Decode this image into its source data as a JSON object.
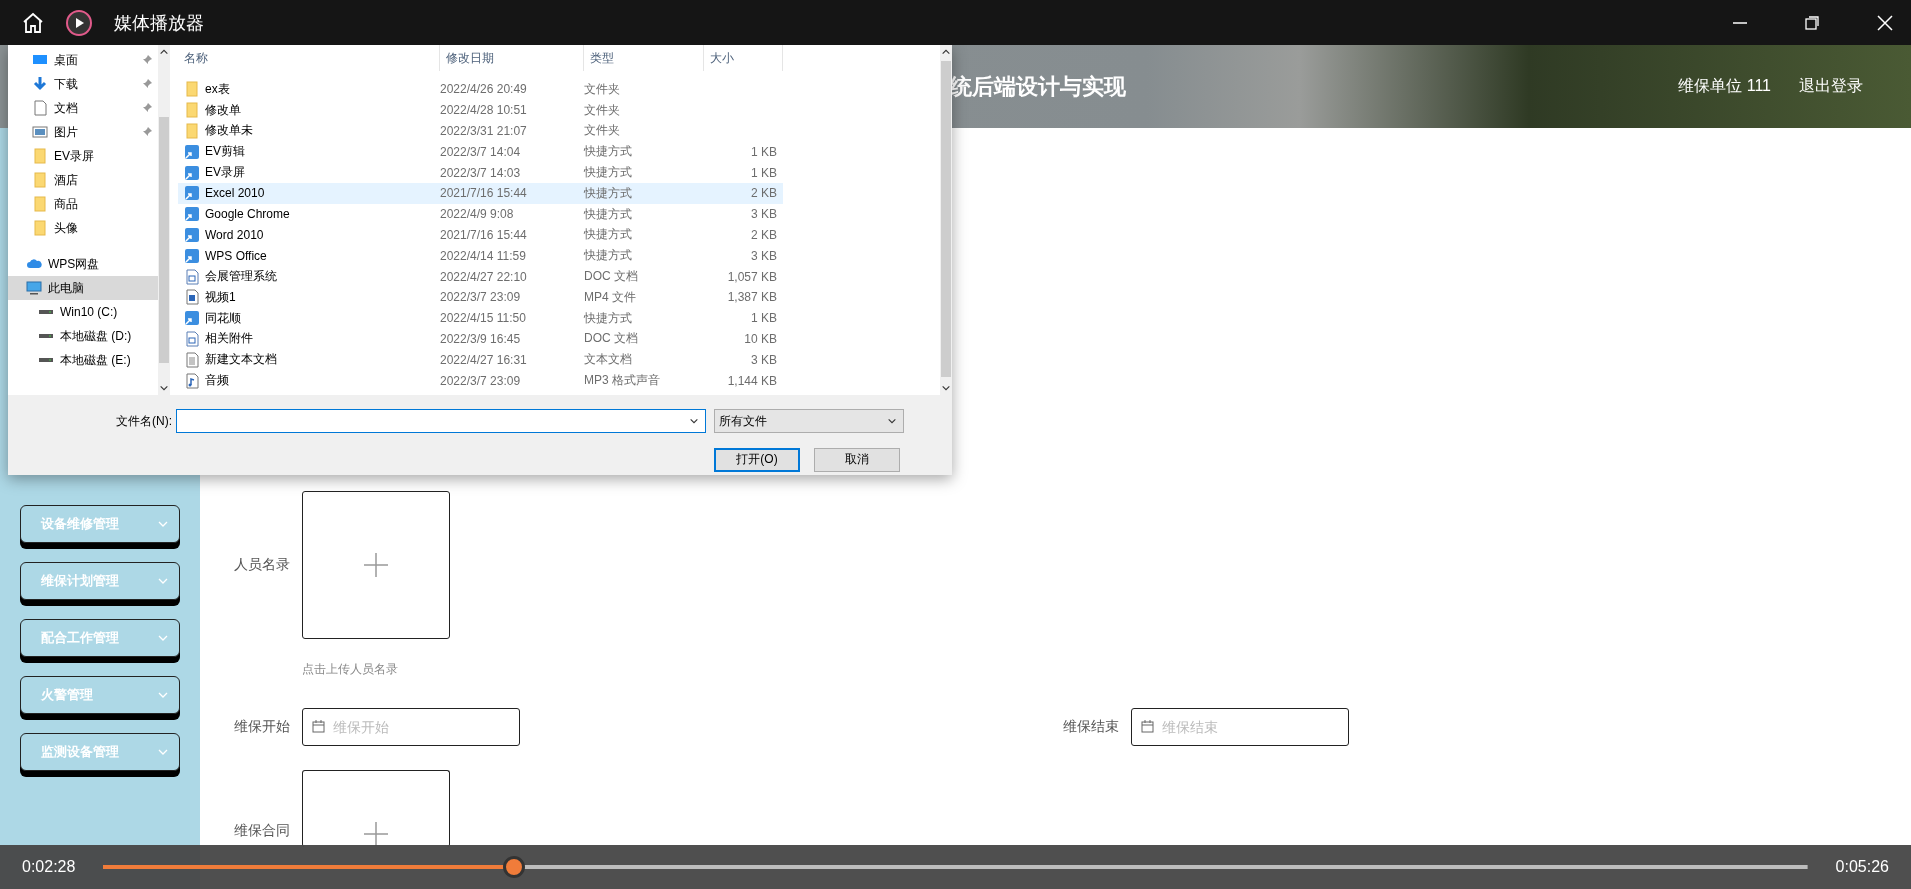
{
  "player": {
    "title": "媒体播放器",
    "time_elapsed": "0:02:28",
    "time_total": "0:05:26",
    "progress": {
      "level": 0.241
    }
  },
  "page": {
    "header": {
      "title": "统后端设计与实现",
      "user": "维保单位 111",
      "logout": "退出登录"
    },
    "sidebar": [
      {
        "label": "设备维修管理"
      },
      {
        "label": "维保计划管理"
      },
      {
        "label": "配合工作管理"
      },
      {
        "label": "火警管理"
      },
      {
        "label": "监测设备管理"
      }
    ],
    "form": {
      "person_upload": {
        "label": "人员名录",
        "hint": "点击上传人员名录"
      },
      "date_fields": [
        {
          "label": "维保开始",
          "placeholder": "维保开始"
        },
        {
          "label": "维保结束",
          "placeholder": "维保结束"
        }
      ],
      "contract_upload": {
        "label": "维保合同"
      }
    }
  },
  "dialog": {
    "nav": [
      {
        "label": "桌面",
        "kind": "desktop",
        "pinned": true,
        "selected": false
      },
      {
        "label": "下载",
        "kind": "download",
        "pinned": true,
        "selected": false
      },
      {
        "label": "文档",
        "kind": "document",
        "pinned": true,
        "selected": false
      },
      {
        "label": "图片",
        "kind": "picture",
        "pinned": true,
        "selected": false
      },
      {
        "label": "EV录屏",
        "kind": "folder",
        "pinned": false,
        "selected": false
      },
      {
        "label": "酒店",
        "kind": "folder",
        "pinned": false,
        "selected": false
      },
      {
        "label": "商品",
        "kind": "folder",
        "pinned": false,
        "selected": false
      },
      {
        "label": "头像",
        "kind": "folder",
        "pinned": false,
        "selected": false
      },
      {
        "label": "WPS网盘",
        "kind": "cloud",
        "pinned": false,
        "selected": false
      },
      {
        "label": "此电脑",
        "kind": "computer",
        "pinned": false,
        "selected": true
      },
      {
        "label": "Win10 (C:)",
        "kind": "drive",
        "pinned": false,
        "selected": false
      },
      {
        "label": "本地磁盘 (D:)",
        "kind": "drive",
        "pinned": false,
        "selected": false
      },
      {
        "label": "本地磁盘 (E:)",
        "kind": "drive",
        "pinned": false,
        "selected": false
      }
    ],
    "columns": [
      "名称",
      "修改日期",
      "类型",
      "大小"
    ],
    "files": [
      {
        "name": "ex表",
        "date": "2022/4/26 20:49",
        "type": "文件夹",
        "kind": "folder",
        "selected": false
      },
      {
        "name": "修改单",
        "date": "2022/4/28 10:51",
        "type": "文件夹",
        "kind": "folder",
        "selected": false
      },
      {
        "name": "修改单未",
        "date": "2022/3/31 21:07",
        "type": "文件夹",
        "kind": "folder",
        "selected": false
      },
      {
        "name": "EV剪辑",
        "date": "2022/3/7 14:04",
        "type": "快捷方式",
        "size": "1 KB",
        "kind": "shortcut",
        "selected": false
      },
      {
        "name": "EV录屏",
        "date": "2022/3/7 14:03",
        "type": "快捷方式",
        "size": "1 KB",
        "kind": "shortcut",
        "selected": false
      },
      {
        "name": "Excel 2010",
        "date": "2021/7/16 15:44",
        "type": "快捷方式",
        "size": "2 KB",
        "kind": "shortcut",
        "selected": true
      },
      {
        "name": "Google Chrome",
        "date": "2022/4/9 9:08",
        "type": "快捷方式",
        "size": "3 KB",
        "kind": "shortcut",
        "selected": false
      },
      {
        "name": "Word 2010",
        "date": "2021/7/16 15:44",
        "type": "快捷方式",
        "size": "2 KB",
        "kind": "shortcut",
        "selected": false
      },
      {
        "name": "WPS Office",
        "date": "2022/4/14 11:59",
        "type": "快捷方式",
        "size": "3 KB",
        "kind": "shortcut",
        "selected": false
      },
      {
        "name": "会展管理系统",
        "date": "2022/4/27 22:10",
        "type": "DOC 文档",
        "size": "1,057 KB",
        "kind": "doc",
        "selected": false
      },
      {
        "name": "视频1",
        "date": "2022/3/7 23:09",
        "type": "MP4 文件",
        "size": "1,387 KB",
        "kind": "video",
        "selected": false
      },
      {
        "name": "同花顺",
        "date": "2022/4/15 11:50",
        "type": "快捷方式",
        "size": "1 KB",
        "kind": "shortcut",
        "selected": false
      },
      {
        "name": "相关附件",
        "date": "2022/3/9 16:45",
        "type": "DOC 文档",
        "size": "10 KB",
        "kind": "doc",
        "selected": false
      },
      {
        "name": "新建文本文档",
        "date": "2022/4/27 16:31",
        "type": "文本文档",
        "size": "3 KB",
        "kind": "text",
        "selected": false
      },
      {
        "name": "音频",
        "date": "2022/3/7 23:09",
        "type": "MP3 格式声音",
        "size": "1,144 KB",
        "kind": "audio",
        "selected": false
      }
    ],
    "filename_label": "文件名(N):",
    "filter": "所有文件",
    "open": "打开(O)",
    "cancel": "取消"
  }
}
